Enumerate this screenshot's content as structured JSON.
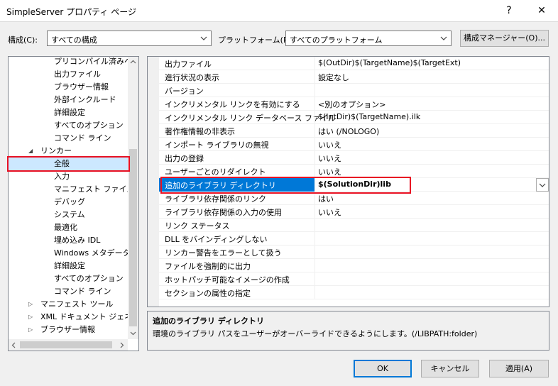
{
  "window": {
    "title": "SimpleServer プロパティ ページ",
    "help_glyph": "?",
    "close_glyph": "✕"
  },
  "toolbar": {
    "config_label": "構成(C):",
    "config_value": "すべての構成",
    "platform_label": "プラットフォーム(P):",
    "platform_value": "すべてのプラットフォーム",
    "config_manager_label": "構成マネージャー(O)..."
  },
  "tree": {
    "items": [
      {
        "label": "プリコンパイル済みヘッ",
        "expander": ""
      },
      {
        "label": "出力ファイル",
        "expander": ""
      },
      {
        "label": "ブラウザー情報",
        "expander": ""
      },
      {
        "label": "外部インクルード",
        "expander": ""
      },
      {
        "label": "詳細設定",
        "expander": ""
      },
      {
        "label": "すべてのオプション",
        "expander": ""
      },
      {
        "label": "コマンド ライン",
        "expander": ""
      },
      {
        "label": "リンカー",
        "expander": "◢"
      },
      {
        "label": "全般",
        "expander": ""
      },
      {
        "label": "入力",
        "expander": ""
      },
      {
        "label": "マニフェスト ファイル",
        "expander": ""
      },
      {
        "label": "デバッグ",
        "expander": ""
      },
      {
        "label": "システム",
        "expander": ""
      },
      {
        "label": "最適化",
        "expander": ""
      },
      {
        "label": "埋め込み IDL",
        "expander": ""
      },
      {
        "label": "Windows メタデータ",
        "expander": ""
      },
      {
        "label": "詳細設定",
        "expander": ""
      },
      {
        "label": "すべてのオプション",
        "expander": ""
      },
      {
        "label": "コマンド ライン",
        "expander": ""
      },
      {
        "label": "マニフェスト ツール",
        "expander": "▷"
      },
      {
        "label": "XML ドキュメント ジェネレー",
        "expander": "▷"
      },
      {
        "label": "ブラウザー情報",
        "expander": "▷"
      }
    ]
  },
  "grid": {
    "rows": [
      {
        "name": "出力ファイル",
        "value": "$(OutDir)$(TargetName)$(TargetExt)"
      },
      {
        "name": "進行状況の表示",
        "value": "設定なし"
      },
      {
        "name": "バージョン",
        "value": ""
      },
      {
        "name": "インクリメンタル リンクを有効にする",
        "value": "<別のオプション>"
      },
      {
        "name": "インクリメンタル リンク データベース ファイル",
        "value": "$(IntDir)$(TargetName).ilk"
      },
      {
        "name": "著作権情報の非表示",
        "value": "はい (/NOLOGO)"
      },
      {
        "name": "インポート ライブラリの無視",
        "value": "いいえ"
      },
      {
        "name": "出力の登録",
        "value": "いいえ"
      },
      {
        "name": "ユーザーごとのリダイレクト",
        "value": "いいえ"
      },
      {
        "name": "追加のライブラリ ディレクトリ",
        "value": "$(SolutionDir)lib"
      },
      {
        "name": "ライブラリ依存関係のリンク",
        "value": "はい"
      },
      {
        "name": "ライブラリ依存関係の入力の使用",
        "value": "いいえ"
      },
      {
        "name": "リンク ステータス",
        "value": ""
      },
      {
        "name": "DLL をバインディングしない",
        "value": ""
      },
      {
        "name": "リンカー警告をエラーとして扱う",
        "value": ""
      },
      {
        "name": "ファイルを強制的に出力",
        "value": ""
      },
      {
        "name": "ホットパッチ可能なイメージの作成",
        "value": ""
      },
      {
        "name": "セクションの属性の指定",
        "value": ""
      }
    ]
  },
  "description": {
    "title": "追加のライブラリ ディレクトリ",
    "text": "環境のライブラリ パスをユーザーがオーバーライドできるようにします。(/LIBPATH:folder)"
  },
  "buttons": {
    "ok": "OK",
    "cancel": "キャンセル",
    "apply": "適用(A)"
  },
  "colors": {
    "selection": "#0078d7",
    "tree_selection": "#cce8ff",
    "highlight_box": "#e81123"
  }
}
